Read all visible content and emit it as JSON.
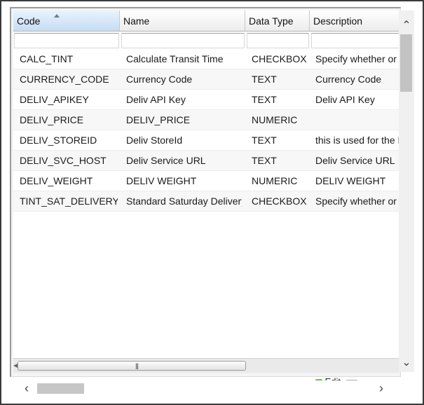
{
  "grid": {
    "columns": [
      "Code",
      "Name",
      "Data Type",
      "Description"
    ],
    "sorted_column": "Code",
    "sort_direction": "ascending",
    "rows": [
      {
        "code": "CALC_TINT",
        "name": "Calculate Transit Time",
        "type": "CHECKBOX",
        "description": "Specify whether or n"
      },
      {
        "code": "CURRENCY_CODE",
        "name": "Currency Code",
        "type": "TEXT",
        "description": "Currency Code"
      },
      {
        "code": "DELIV_APIKEY",
        "name": "Deliv API Key",
        "type": "TEXT",
        "description": "Deliv API Key"
      },
      {
        "code": "DELIV_PRICE",
        "name": "DELIV_PRICE",
        "type": "NUMERIC",
        "description": ""
      },
      {
        "code": "DELIV_STOREID",
        "name": "Deliv StoreId",
        "type": "TEXT",
        "description": "this is used for the D"
      },
      {
        "code": "DELIV_SVC_HOST",
        "name": "Deliv Service URL",
        "type": "TEXT",
        "description": "Deliv Service URL"
      },
      {
        "code": "DELIV_WEIGHT",
        "name": "DELIV WEIGHT",
        "type": "NUMERIC",
        "description": "DELIV WEIGHT"
      },
      {
        "code": "TINT_SAT_DELIVERY",
        "name": "Standard Saturday Delivery",
        "type": "CHECKBOX",
        "description": "Specify whether or n"
      }
    ]
  },
  "status_bar": {
    "edit_text": "Edit"
  },
  "icons": {
    "scroll_up": "chevron-up-icon",
    "scroll_down": "chevron-down-icon",
    "scroll_left": "chevron-left-icon",
    "scroll_right": "chevron-right-icon",
    "sort": "sort-ascending-icon",
    "edit": "edit-icon"
  }
}
